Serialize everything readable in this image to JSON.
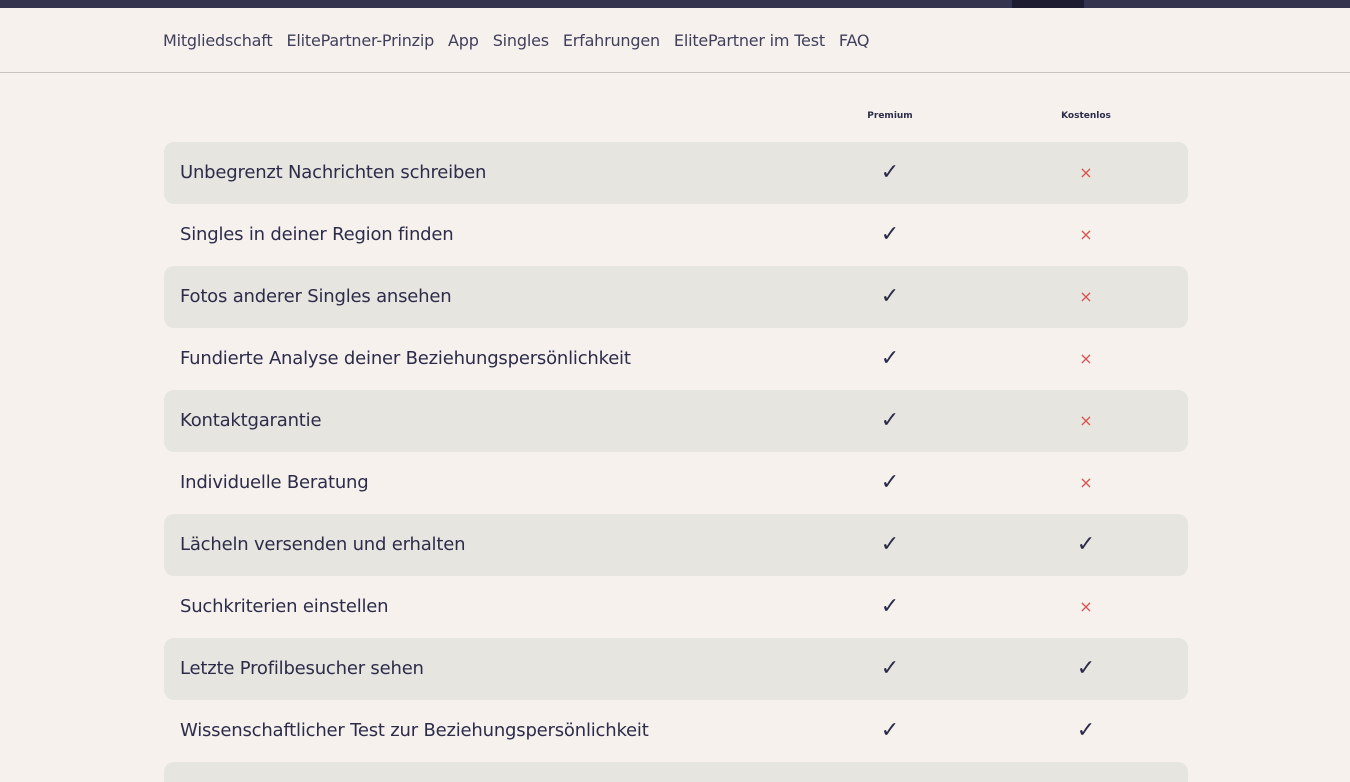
{
  "nav": {
    "items": [
      {
        "label": "Mitgliedschaft"
      },
      {
        "label": "ElitePartner-Prinzip"
      },
      {
        "label": "App"
      },
      {
        "label": "Singles"
      },
      {
        "label": "Erfahrungen"
      },
      {
        "label": "ElitePartner im Test"
      },
      {
        "label": "FAQ"
      }
    ]
  },
  "table": {
    "columns": {
      "premium": "Premium",
      "free": "Kostenlos"
    },
    "check_symbol": "✓",
    "cross_symbol": "×",
    "colors": {
      "check": "#2c2c4a",
      "cross": "#d9534f"
    },
    "rows": [
      {
        "label": "Unbegrenzt Nachrichten schreiben",
        "premium": "check",
        "free": "cross"
      },
      {
        "label": "Singles in deiner Region finden",
        "premium": "check",
        "free": "cross"
      },
      {
        "label": "Fotos anderer Singles ansehen",
        "premium": "check",
        "free": "cross"
      },
      {
        "label": "Fundierte Analyse deiner Beziehungspersönlichkeit",
        "premium": "check",
        "free": "cross"
      },
      {
        "label": "Kontaktgarantie",
        "premium": "check",
        "free": "cross"
      },
      {
        "label": "Individuelle Beratung",
        "premium": "check",
        "free": "cross"
      },
      {
        "label": "Lächeln versenden und erhalten",
        "premium": "check",
        "free": "check"
      },
      {
        "label": "Suchkriterien einstellen",
        "premium": "check",
        "free": "cross"
      },
      {
        "label": "Letzte Profilbesucher sehen",
        "premium": "check",
        "free": "check"
      },
      {
        "label": "Wissenschaftlicher Test zur Beziehungspersönlichkeit",
        "premium": "check",
        "free": "check"
      }
    ]
  }
}
